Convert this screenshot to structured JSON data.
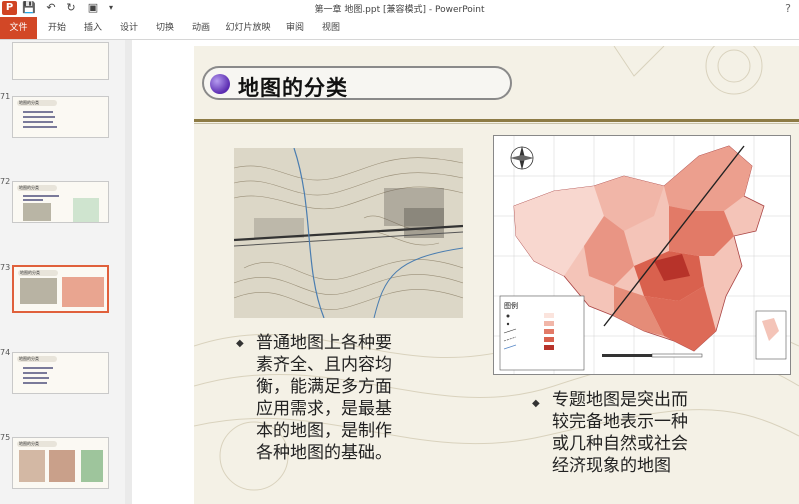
{
  "window": {
    "title": "第一章 地图.ppt [兼容模式] - PowerPoint"
  },
  "ribbon": {
    "tabs": [
      "文件",
      "开始",
      "插入",
      "设计",
      "切换",
      "动画",
      "幻灯片放映",
      "审阅",
      "视图"
    ]
  },
  "slide_panel": {
    "thumbnails": [
      {
        "number": "71",
        "title": "地图的分类"
      },
      {
        "number": "72",
        "title": "地图的分类"
      },
      {
        "number": "73",
        "title": "地图的分类",
        "active": true
      },
      {
        "number": "74",
        "title": "地图的分类"
      },
      {
        "number": "75",
        "title": "地图的分类"
      }
    ]
  },
  "slide": {
    "title": "地图的分类",
    "bullet_left": "普通地图上各种要素齐全、且内容均衡，能满足多方面应用需求，是最基本的地图，是制作各种地图的基础。",
    "bullet_left_lines": [
      "普通地图上各种要",
      "素齐全、且内容均",
      "衡，能满足多方面",
      "应用需求，是最基",
      "本的地图，是制作",
      "各种地图的基础。"
    ],
    "bullet_right_lines": [
      "专题地图是突出而",
      "较完备地表示一种",
      "或几种自然或社会",
      "经济现象的地图"
    ],
    "map_legend_title": "图例"
  },
  "colors": {
    "file_tab": "#d24726",
    "accent_rule": "#8d7b45",
    "active_thumb_border": "#e0603b"
  }
}
